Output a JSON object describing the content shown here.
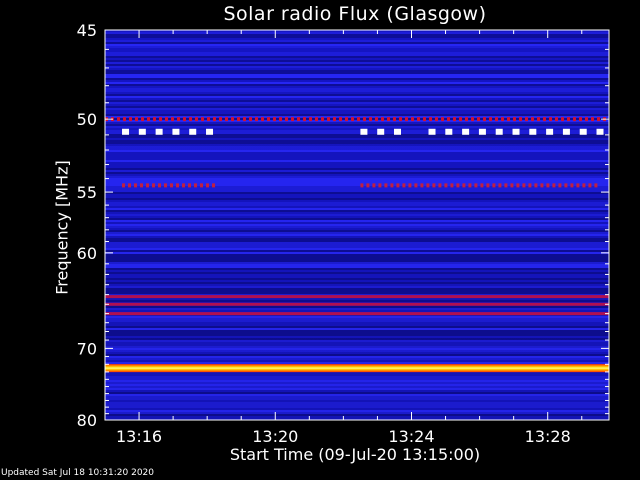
{
  "chart_data": {
    "type": "heatmap",
    "title": "Solar radio Flux (Glasgow)",
    "xlabel": "Start Time (09-Jul-20 13:15:00)",
    "ylabel": "Frequency [MHz]",
    "x_ticks": [
      "13:16",
      "13:20",
      "13:24",
      "13:28"
    ],
    "x_tick_minutes": [
      1,
      5,
      9,
      13
    ],
    "x_range_minutes": [
      0,
      14.8
    ],
    "y_ticks": [
      45,
      50,
      55,
      60,
      70,
      80
    ],
    "y_scale": "reciprocal",
    "ylim": [
      45,
      80
    ],
    "colormap": [
      "#000050",
      "#1010c8",
      "#2a2aff",
      "#c01040",
      "#ff3000",
      "#ffff60"
    ],
    "bands": [
      {
        "freq_mhz": 50.0,
        "level": "high",
        "pattern": "dotted"
      },
      {
        "freq_mhz": 50.8,
        "level": "saturated",
        "pattern": "square-markers",
        "segments_minutes": [
          [
            0.5,
            3.3
          ],
          [
            7.5,
            8.8
          ],
          [
            9.5,
            14.8
          ]
        ]
      },
      {
        "freq_mhz": 54.5,
        "level": "medium",
        "pattern": "dotted",
        "segments_minutes": [
          [
            0.5,
            3.3
          ],
          [
            7.5,
            14.5
          ]
        ]
      },
      {
        "freq_mhz": 64.2,
        "level": "medium",
        "pattern": "solid"
      },
      {
        "freq_mhz": 65.0,
        "level": "medium",
        "pattern": "solid"
      },
      {
        "freq_mhz": 66.0,
        "level": "medium",
        "pattern": "solid"
      },
      {
        "freq_mhz": 72.5,
        "level": "saturated",
        "pattern": "solid"
      }
    ],
    "grid": false,
    "legend": "none"
  },
  "footer": "Updated Sat Jul 18 10:31:20 2020"
}
